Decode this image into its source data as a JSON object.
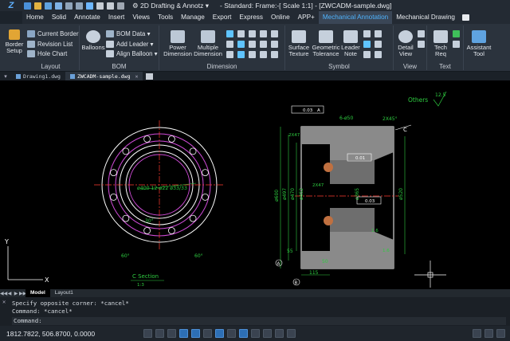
{
  "titlebar": {
    "logo": "Z",
    "workspace": "2D Drafting & Annotz",
    "document_title": "- Standard: Frame:-[ Scale 1:1] - [ZWCADM-sample.dwg]"
  },
  "menu": {
    "items": [
      "Home",
      "Solid",
      "Annotate",
      "Insert",
      "Views",
      "Tools",
      "Manage",
      "Export",
      "Express",
      "Online",
      "APP+",
      "Mechanical Annotation",
      "Mechanical Drawing"
    ],
    "active": "Mechanical Annotation"
  },
  "ribbon": {
    "layout": {
      "label": "Layout",
      "border_setup": "Border\nSetup",
      "current_border": "Current Border",
      "revision_list": "Revision List",
      "hole_chart": "Hole Chart"
    },
    "bom": {
      "label": "BOM",
      "balloons": "Balloons",
      "bom_data": "BOM Data",
      "add_leader": "Add Leader",
      "align_balloon": "Align Balloon"
    },
    "dimension": {
      "label": "Dimension",
      "power_dimension": "Power\nDimension",
      "multiple_dimension": "Multiple\nDimension"
    },
    "symbol": {
      "label": "Symbol",
      "surface_texture": "Surface\nTexture",
      "geometric_tolerance": "Geometric\nTolerance",
      "leader_note": "Leader\nNote"
    },
    "view": {
      "label": "View",
      "detail_view": "Detail\nView"
    },
    "text": {
      "label": "Text",
      "tech_req": "Tech\nReq"
    },
    "assistant": {
      "label": "Assistant\nTool"
    }
  },
  "doctabs": {
    "tabs": [
      "Drawing1.dwg",
      "ZWCADM-sample.dwg"
    ],
    "active": "ZWCADM-sample.dwg"
  },
  "drawing": {
    "others_label": "Others",
    "roughness": "12.5",
    "section_label": "C Section",
    "section_scale": "1:3",
    "circle_note": "ø400  12-ø22  ø33/33",
    "angle_1": "30°",
    "angle_2": "60°",
    "angle_3": "60°",
    "dim_top": "6-ø50",
    "dim_chamfer": "2X45°",
    "tol_1": "0.03",
    "tol_1_ref": "A",
    "tol_2": "0.01",
    "tol_3": "0.03",
    "dim_left_1": "ø600",
    "dim_left_2": "ø497",
    "dim_left_3": "ø470",
    "dim_left_4": "ø452",
    "dim_mid": "ø365",
    "dim_right": "ø520",
    "dim_bottom_1": "55",
    "dim_bottom_2": "115",
    "dim_bottom_3": "50",
    "dim_small_1": "2X47",
    "dim_small_2": "2X47",
    "dim_small_3": "1.6",
    "dim_small_4": "1.6",
    "label_c": "C",
    "label_a": "A",
    "label_b": "B",
    "ucs_y": "Y",
    "ucs_x": "X"
  },
  "layouttabs": {
    "tabs": [
      "Model",
      "Layout1"
    ],
    "active": "Model"
  },
  "command": {
    "lines": [
      "Specify opposite corner: *cancel*",
      "Command: *cancel*"
    ],
    "prompt": "Command:"
  },
  "status": {
    "coordinates": "1812.7822, 506.8700, 0.0000"
  },
  "colors": {
    "accent": "#4fb4ff",
    "drawing_green": "#2ecc40",
    "drawing_magenta": "#d04bd8",
    "drawing_white": "#ffffff",
    "drawing_red": "#ff3b30",
    "drawing_yellow": "#f5d300"
  }
}
